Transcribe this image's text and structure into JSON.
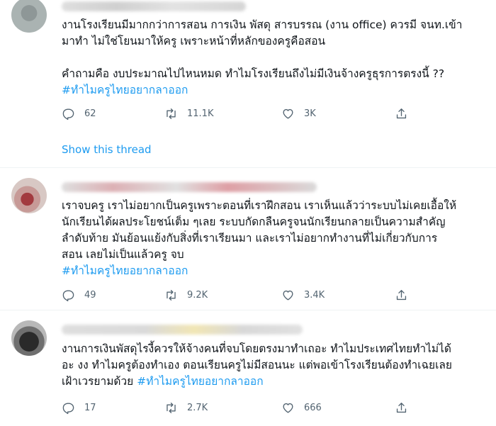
{
  "tweets": [
    {
      "lines": [
        "งานโรงเรียนมีมากกว่าการสอน การเงิน พัสดุ สารบรรณ (งาน office) ควรมี จนท.เข้า",
        "มาทำ ไม่ใช่โยนมาให้ครู เพราะหน้าที่หลักของครูคือสอน",
        "",
        "คำถามคือ งบประมาณไปไหนหมด ทำไมโรงเรียนถึงไม่มีเงินจ้างครูธุรการตรงนี้ ??"
      ],
      "hashtag": "#ทำไมครูไทยอยากลาออก",
      "replies": "62",
      "retweets": "11.1K",
      "likes": "3K",
      "show_thread": "Show this thread"
    },
    {
      "lines": [
        "เราจบครู เราไม่อยากเป็นครูเพราะตอนที่เราฝึกสอน เราเห็นแล้วว่าระบบไม่เคยเอื้อให้",
        "นักเรียนได้ผลประโยชน์เต็ม ๆเลย ระบบกัดกลืนครูจนนักเรียนกลายเป็นความสำคัญ",
        "ลำดับท้าย มันย้อนแย้งกับสิ่งที่เราเรียนมา และเราไม่อยากทำงานที่ไม่เกี่ยวกับการ",
        "สอน เลยไม่เป็นแล้วครู จบ"
      ],
      "hashtag": "#ทำไมครูไทยอยากลาออก",
      "replies": "49",
      "retweets": "9.2K",
      "likes": "3.4K"
    },
    {
      "lines": [
        "งานการเงินพัสดุไรงี้ควรให้จ้างคนที่จบโดยตรงมาทำเถอะ ทำไมประเทศไทยทำไม่ได้",
        "อะ งง ทำไมครูต้องทำเอง ตอนเรียนครูไม่มีสอนนะ แต่พอเข้าโรงเรียนต้องทำเฉยเลย",
        "เฝ้าเวรยามด้วย"
      ],
      "hashtag": "#ทำไมครูไทยอยากลาออก",
      "replies": "17",
      "retweets": "2.7K",
      "likes": "666"
    }
  ]
}
